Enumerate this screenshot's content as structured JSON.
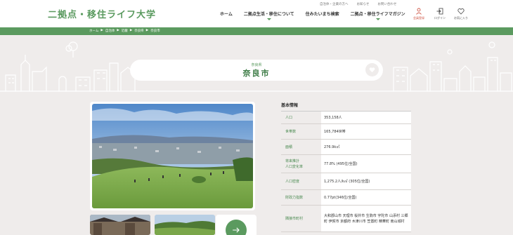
{
  "header": {
    "logo": "二拠点・移住ライフ大学",
    "subnav": [
      "自治体・企業の方へ",
      "お知らせ",
      "お問い合わせ"
    ],
    "mainnav": [
      {
        "label": "ホーム",
        "caret": false
      },
      {
        "label": "二拠点生活・移住について",
        "caret": true
      },
      {
        "label": "住みたいまち検索",
        "caret": false
      },
      {
        "label": "二拠点・移住ライフマガジン",
        "caret": true
      }
    ],
    "icons": [
      {
        "name": "member-register-icon",
        "label": "会員登録"
      },
      {
        "name": "login-icon",
        "label": "ログイン"
      },
      {
        "name": "favorite-icon",
        "label": "お気に入り"
      }
    ]
  },
  "breadcrumb": [
    "ホーム",
    "▶",
    "自治体",
    "▶",
    "近畿",
    "▶",
    "奈良県",
    "▶",
    "奈良市"
  ],
  "title": {
    "prefecture": "奈良県",
    "city": "奈良市"
  },
  "info": {
    "heading": "基本情報",
    "rows": [
      {
        "key": "人口",
        "value": "353,158人"
      },
      {
        "key": "世帯数",
        "value": "165,784世帯"
      },
      {
        "key": "面積",
        "value": "276.9k㎡"
      },
      {
        "key": "将来推計\n人口変化率",
        "value": "77.8% (495位/全国)"
      },
      {
        "key": "人口密度",
        "value": "1,275.2人/k㎡ (305位/全国)"
      },
      {
        "key": "財政力指数",
        "value": "0.77pt(346位/全国)"
      },
      {
        "key": "隣接市町村",
        "value": "大和郡山市 天理市 桜井市 生駒市 宇陀市 山添村 三郷町 伊賀市 京都府 木津川市 笠置町 精華町 南山城村"
      }
    ]
  },
  "colors": {
    "accent": "#5b9a5f",
    "background": "#efeceb"
  }
}
